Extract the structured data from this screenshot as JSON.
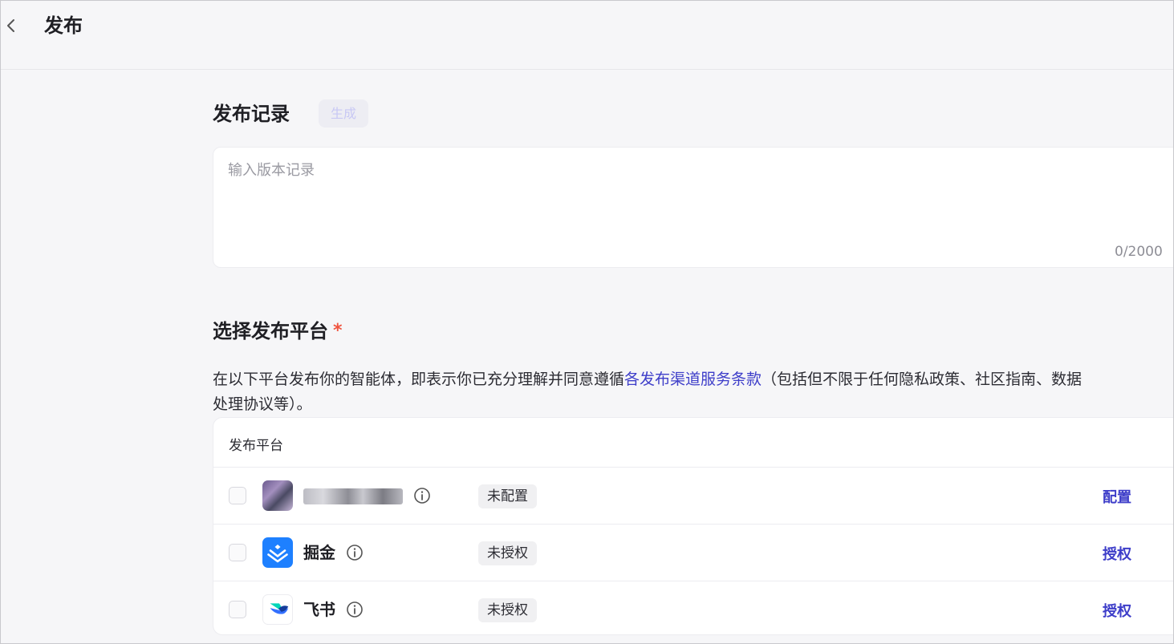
{
  "header": {
    "title": "发布"
  },
  "record": {
    "section_title": "发布记录",
    "generate_label": "生成",
    "placeholder": "输入版本记录",
    "value": "",
    "char_count": "0/2000"
  },
  "platforms": {
    "section_title": "选择发布平台",
    "required_mark": "*",
    "desc_before": "在以下平台发布你的智能体，即表示你已充分理解并同意遵循",
    "terms_link": "各发布渠道服务条款",
    "desc_after": "（包括但不限于任何隐私政策、社区指南、数据",
    "desc_line2": "处理协议等）。",
    "table_header": "发布平台",
    "rows": [
      {
        "name": "",
        "name_obscured": true,
        "status": "未配置",
        "action": "配置",
        "icon": "obscured-platform-logo"
      },
      {
        "name": "掘金",
        "status": "未授权",
        "action": "授权",
        "icon": "juejin-logo"
      },
      {
        "name": "飞书",
        "status": "未授权",
        "action": "授权",
        "icon": "feishu-logo"
      }
    ]
  },
  "colors": {
    "accent": "#3e3ec9",
    "required": "#f0543f",
    "juejin": "#1e80ff"
  }
}
